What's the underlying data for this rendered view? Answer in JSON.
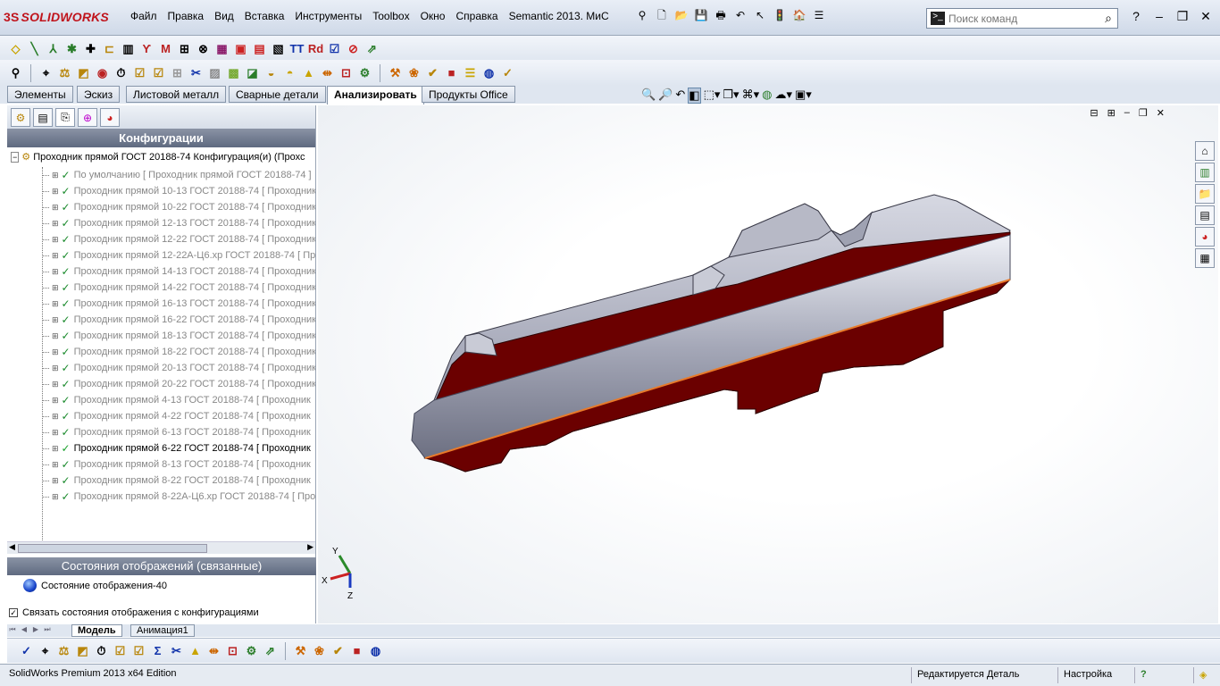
{
  "app": {
    "logo": "SOLIDWORKS",
    "logo_mark": "3S"
  },
  "menu": [
    "Файл",
    "Правка",
    "Вид",
    "Вставка",
    "Инструменты",
    "Toolbox",
    "Окно",
    "Справка",
    "Semantic 2013. МиС"
  ],
  "search": {
    "placeholder": "Поиск команд"
  },
  "cm_tabs": [
    "Элементы",
    "Эскиз",
    "Листовой металл",
    "Сварные детали",
    "Анализировать",
    "Продукты Office"
  ],
  "cm_active": "Анализировать",
  "panel": {
    "header": "Конфигурации",
    "root": "Проходник прямой ГОСТ 20188-74 Конфигурация(и)  (Прохс",
    "items": [
      "По умолчанию [ Проходник прямой ГОСТ 20188-74 ]",
      "Проходник прямой 10-13 ГОСТ 20188-74 [ Проходник",
      "Проходник прямой 10-22 ГОСТ 20188-74 [ Проходник",
      "Проходник прямой 12-13 ГОСТ 20188-74 [ Проходник",
      "Проходник прямой 12-22 ГОСТ 20188-74 [ Проходник",
      "Проходник прямой 12-22А-Ц6.хр ГОСТ 20188-74 [ Пр",
      "Проходник прямой 14-13 ГОСТ 20188-74 [ Проходник",
      "Проходник прямой 14-22 ГОСТ 20188-74 [ Проходник",
      "Проходник прямой 16-13 ГОСТ 20188-74 [ Проходник",
      "Проходник прямой 16-22 ГОСТ 20188-74 [ Проходник",
      "Проходник прямой 18-13 ГОСТ 20188-74 [ Проходник",
      "Проходник прямой 18-22 ГОСТ 20188-74 [ Проходник",
      "Проходник прямой 20-13 ГОСТ 20188-74 [ Проходник",
      "Проходник прямой 20-22 ГОСТ 20188-74 [ Проходник",
      "Проходник прямой 4-13 ГОСТ 20188-74 [ Проходник",
      "Проходник прямой 4-22 ГОСТ 20188-74 [ Проходник",
      "Проходник прямой 6-13 ГОСТ 20188-74 [ Проходник",
      "Проходник прямой 6-22 ГОСТ 20188-74 [ Проходник",
      "Проходник прямой 8-13 ГОСТ 20188-74 [ Проходник",
      "Проходник прямой 8-22 ГОСТ 20188-74 [ Проходник",
      "Проходник прямой 8-22А-Ц6.хр ГОСТ 20188-74 [ Про"
    ],
    "active_index": 17,
    "display_header": "Состояния отображений (связанные)",
    "display_state": "Состояние отображения-40",
    "link_label": "Связать состояния отображения с конфигурациями",
    "link_checked": true
  },
  "triad": {
    "y": "Y",
    "x": "X",
    "z": "Z"
  },
  "bottom_tabs": [
    "Модель",
    "Анимация1"
  ],
  "bottom_active": "Модель",
  "status": {
    "edition": "SolidWorks Premium 2013 x64 Edition",
    "editing": "Редактируется Деталь",
    "settings": "Настройка",
    "help": "?"
  },
  "colors": {
    "section": "#6b0000",
    "metal": "#b7b9c6",
    "edge": "#e87a2a"
  }
}
